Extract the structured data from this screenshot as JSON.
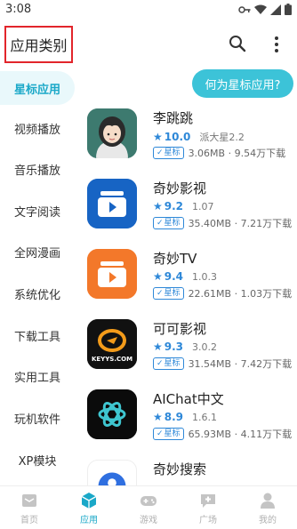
{
  "status": {
    "time": "3:08"
  },
  "header": {
    "title": "应用类别"
  },
  "categories": [
    {
      "label": "星标应用",
      "active": true
    },
    {
      "label": "视频播放"
    },
    {
      "label": "音乐播放"
    },
    {
      "label": "文字阅读"
    },
    {
      "label": "全网漫画"
    },
    {
      "label": "系统优化"
    },
    {
      "label": "下载工具"
    },
    {
      "label": "实用工具"
    },
    {
      "label": "玩机软件"
    },
    {
      "label": "XP模块"
    }
  ],
  "tip": {
    "label": "何为星标应用?"
  },
  "apps": [
    {
      "name": "李跳跳",
      "score": "10.0",
      "version": "派大星2.2",
      "badge": "星标",
      "meta": "3.06MB · 9.54万下载"
    },
    {
      "name": "奇妙影视",
      "score": "9.2",
      "version": "1.07",
      "badge": "星标",
      "meta": "35.40MB · 7.21万下载"
    },
    {
      "name": "奇妙TV",
      "score": "9.4",
      "version": "1.0.3",
      "badge": "星标",
      "meta": "22.61MB · 1.03万下载"
    },
    {
      "name": "可可影视",
      "score": "9.3",
      "version": "3.0.2",
      "badge": "星标",
      "meta": "31.54MB · 7.42万下载"
    },
    {
      "name": "AIChat中文",
      "score": "8.9",
      "version": "1.6.1",
      "badge": "星标",
      "meta": "65.93MB · 4.11万下载"
    },
    {
      "name": "奇妙搜索",
      "score": "",
      "version": "",
      "badge": "",
      "meta": ""
    }
  ],
  "bottom_nav": [
    {
      "label": "首页",
      "icon": "home-icon"
    },
    {
      "label": "应用",
      "icon": "apps-cube-icon",
      "active": true
    },
    {
      "label": "游戏",
      "icon": "gamepad-icon"
    },
    {
      "label": "广场",
      "icon": "chat-plaza-icon"
    },
    {
      "label": "我的",
      "icon": "profile-icon"
    }
  ],
  "colors": {
    "accent": "#1aa8c8",
    "star_blue": "#2e88d8",
    "tip_bg": "#3cc3d8",
    "highlight_border": "#e2252b"
  },
  "app_icon_colors": {
    "kekeys_text": "KEYYS.COM"
  }
}
